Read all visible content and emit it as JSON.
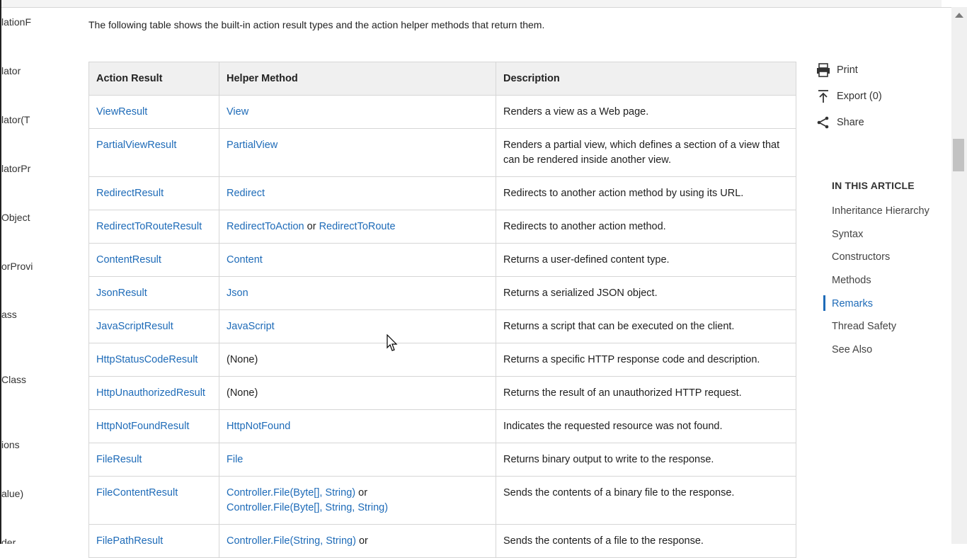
{
  "left_toc": [
    "lationF",
    "lator",
    "lator(T",
    "latorPr",
    "Object",
    "orProvi",
    "ass",
    "Class",
    "ions",
    "alue)",
    "der"
  ],
  "intro": "The following table shows the built-in action result types and the action helper methods that return them.",
  "table": {
    "headers": [
      "Action Result",
      "Helper Method",
      "Description"
    ],
    "rows": [
      {
        "result": "ViewResult",
        "helper": [
          "View"
        ],
        "desc": "Renders a view as a Web page."
      },
      {
        "result": "PartialViewResult",
        "helper": [
          "PartialView"
        ],
        "desc": "Renders a partial view, which defines a section of a view that can be rendered inside another view."
      },
      {
        "result": "RedirectResult",
        "helper": [
          "Redirect"
        ],
        "desc": "Redirects to another action method by using its URL."
      },
      {
        "result": "RedirectToRouteResult",
        "helper": [
          "RedirectToAction",
          "or",
          "RedirectToRoute"
        ],
        "desc": "Redirects to another action method."
      },
      {
        "result": "ContentResult",
        "helper": [
          "Content"
        ],
        "desc": "Returns a user-defined content type."
      },
      {
        "result": "JsonResult",
        "helper": [
          "Json"
        ],
        "desc": "Returns a serialized JSON object."
      },
      {
        "result": "JavaScriptResult",
        "helper": [
          "JavaScript"
        ],
        "desc": "Returns a script that can be executed on the client."
      },
      {
        "result": "HttpStatusCodeResult",
        "helper": [
          "(None)"
        ],
        "desc": "Returns a specific HTTP response code and description."
      },
      {
        "result": "HttpUnauthorizedResult",
        "helper": [
          "(None)"
        ],
        "desc": "Returns the result of an unauthorized HTTP request."
      },
      {
        "result": "HttpNotFoundResult",
        "helper": [
          "HttpNotFound"
        ],
        "desc": "Indicates the requested resource was not found."
      },
      {
        "result": "FileResult",
        "helper": [
          "File"
        ],
        "desc": "Returns binary output to write to the response."
      },
      {
        "result": "FileContentResult",
        "helper": [
          "Controller.File(Byte[], String)",
          "or",
          "Controller.File(Byte[], String, String)"
        ],
        "desc": "Sends the contents of a binary file to the response."
      },
      {
        "result": "FilePathResult",
        "helper": [
          "Controller.File(String, String)",
          "or"
        ],
        "desc": "Sends the contents of a file to the response."
      }
    ]
  },
  "actions": {
    "print": "Print",
    "export": "Export (0)",
    "share": "Share"
  },
  "in_this_article": {
    "heading": "IN THIS ARTICLE",
    "items": [
      "Inheritance Hierarchy",
      "Syntax",
      "Constructors",
      "Methods",
      "Remarks",
      "Thread Safety",
      "See Also"
    ],
    "active": "Remarks"
  },
  "colors": {
    "link": "#1e6bb8",
    "header_bg": "#f0f0f0",
    "border": "#d6d6d6"
  }
}
